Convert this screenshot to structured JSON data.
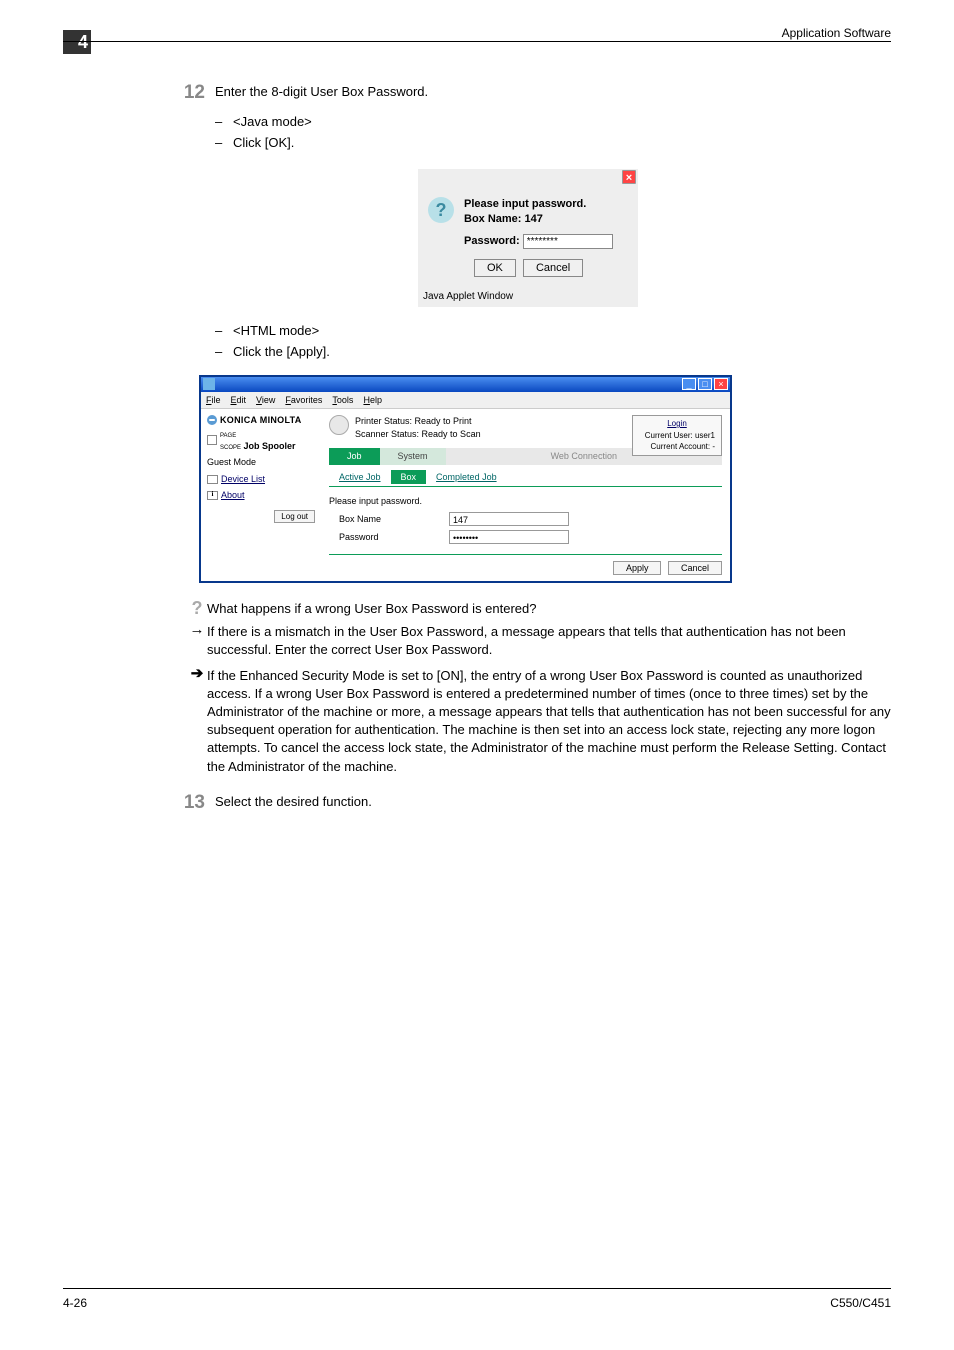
{
  "header": {
    "chapter_num": "4",
    "section_title": "Application Software"
  },
  "footer": {
    "page_label": "4-26",
    "doc_model": "C550/C451"
  },
  "step12": {
    "number": "12",
    "instruction": "Enter the 8-digit User Box Password.",
    "java_mode_label": "<Java mode>",
    "java_click": "Click [OK].",
    "html_mode_label": "<HTML mode>",
    "html_click": "Click the [Apply]."
  },
  "java_dialog": {
    "msg": "Please input password.",
    "box_name_lbl": "Box Name: 147",
    "pw_lbl": "Password:",
    "pw_value": "********",
    "ok": "OK",
    "cancel": "Cancel",
    "status": "Java Applet Window"
  },
  "browser": {
    "menu": {
      "file": "File",
      "edit": "Edit",
      "view": "View",
      "fav": "Favorites",
      "tools": "Tools",
      "help": "Help"
    },
    "sidebar": {
      "brand": "KONICA MINOLTA",
      "product_prefix": "PAGE SCOPE",
      "product": "Job Spooler",
      "mode": "Guest Mode",
      "device_list": "Device List",
      "about": "About",
      "logout": "Log out"
    },
    "status": {
      "printer": "Printer Status: Ready to Print",
      "scanner": "Scanner Status: Ready to Scan"
    },
    "rightbox": {
      "login": "Login",
      "user": "Current User: user1",
      "acct": "Current Account: -"
    },
    "tabs1": {
      "job": "Job",
      "system": "System",
      "web": "Web Connection"
    },
    "tabs2": {
      "active": "Active Job",
      "box": "Box",
      "completed": "Completed Job"
    },
    "form": {
      "msg": "Please input password.",
      "box_name_lbl": "Box Name",
      "box_name_val": "147",
      "pw_lbl": "Password",
      "pw_val": "••••••••",
      "apply": "Apply",
      "cancel": "Cancel"
    }
  },
  "qa": {
    "q": "What happens if a wrong User Box Password is entered?",
    "a1": "If there is a mismatch in the User Box Password, a message appears that tells that authentication has not been successful. Enter the correct User Box Password.",
    "a2": "If the Enhanced Security Mode is set to [ON], the entry of a wrong User Box Password is counted as unauthorized access. If a wrong User Box Password is entered a predetermined number of times (once to three times) set by the Administrator of the machine or more, a message appears that tells that authentication has not been successful for any subsequent operation for authentication. The machine is then set into an access lock state, rejecting any more logon attempts. To cancel the access lock state, the Administrator of the machine must perform the Release Setting. Contact the Administrator of the machine."
  },
  "step13": {
    "number": "13",
    "instruction": "Select the desired function."
  }
}
